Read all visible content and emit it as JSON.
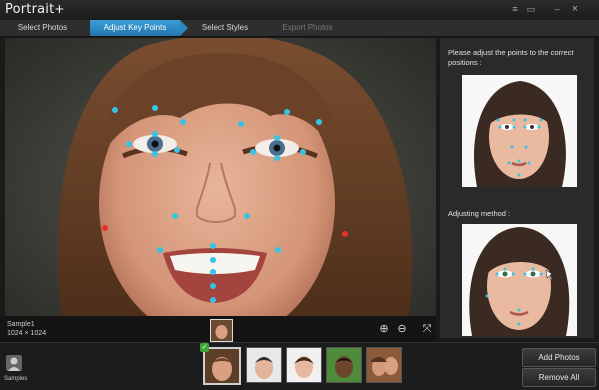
{
  "app": {
    "title": "Portrait",
    "plus": "+"
  },
  "steps": [
    {
      "label": "Select Photos"
    },
    {
      "label": "Adjust Key Points"
    },
    {
      "label": "Select Styles"
    },
    {
      "label": "Export Photos"
    }
  ],
  "window_controls": {
    "menu": "≡",
    "restore": "▭",
    "minimize": "–",
    "close": "×"
  },
  "sample": {
    "name": "Sample1",
    "size": "1024 × 1024"
  },
  "right_panel": {
    "instruction": "Please adjust the points to the correct positions :",
    "method_label": "Adjusting method :"
  },
  "zoom": {
    "in": "⊕",
    "out": "⊖",
    "fit": "⤧"
  },
  "bottom": {
    "samples_label": "Samples",
    "add_button": "Add Photos",
    "remove_button": "Remove All",
    "check": "✓"
  },
  "colors": {
    "accent": "#2f86c4",
    "keypoint": "#35c3e6",
    "keypoint_edge": "#e8312a"
  }
}
